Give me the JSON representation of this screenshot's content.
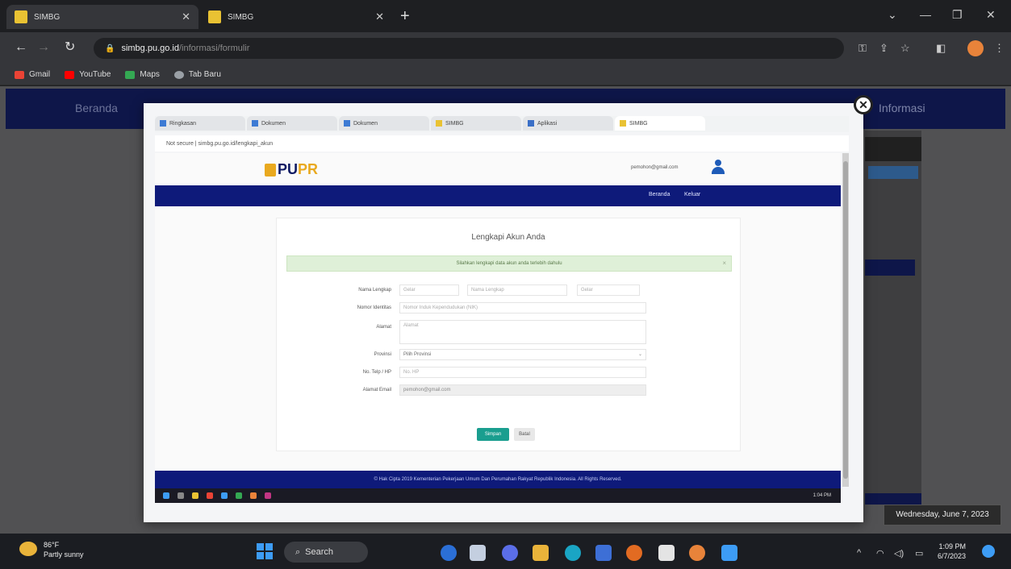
{
  "browser": {
    "tabs": [
      {
        "title": "SIMBG",
        "active": true
      },
      {
        "title": "SIMBG",
        "active": false
      }
    ],
    "new_tab": "+",
    "url_host": "simbg.pu.go.id",
    "url_path": "/informasi/formulir",
    "bookmarks": [
      {
        "label": "Gmail",
        "color": "#ea4335"
      },
      {
        "label": "YouTube",
        "color": "#ff0000"
      },
      {
        "label": "Maps",
        "color": "#34a853"
      },
      {
        "label": "Tab Baru",
        "color": "#9aa0a6"
      }
    ]
  },
  "background_page": {
    "nav_left": "Beranda",
    "nav_right": "Informasi"
  },
  "modal": {
    "close_symbol": "✕",
    "inner_tabs": [
      "Ringkasan",
      "Dokumen",
      "Dokumen",
      "SIMBG",
      "Aplikasi",
      "SIMBG"
    ],
    "inner_url": "Not secure | simbg.pu.go.id/lengkapi_akun",
    "site": {
      "logo_main": "PU",
      "logo_accent": "PR",
      "user_email": "pemohon@gmail.com",
      "nav_links": [
        "Beranda",
        "Keluar"
      ],
      "card_title": "Lengkapi Akun Anda",
      "alert_text": "Silahkan lengkapi data akun anda terlebih dahulu",
      "alert_close": "×",
      "form": {
        "nama_lengkap_label": "Nama Lengkap",
        "nama_fields": [
          "Gelar",
          "Nama Lengkap",
          "Gelar"
        ],
        "nomor_identitas_label": "Nomor Identitas",
        "nomor_identitas_placeholder": "Nomor Induk Kependudukan (NIK)",
        "alamat_label": "Alamat",
        "alamat_placeholder": "Alamat",
        "provinsi_label": "Provinsi",
        "provinsi_value": "Pilih Provinsi",
        "no_hp_label": "No. Telp / HP",
        "no_hp_placeholder": "No. HP",
        "email_label": "Alamat Email",
        "email_value": "pemohon@gmail.com"
      },
      "submit_label": "Simpan",
      "reset_label": "Batal",
      "footer_text": "© Hak Cipta 2019 Kementerian Pekerjaan Umum Dan Perumahan Rakyat Republik Indonesia. All Rights Reserved.",
      "taskbar_time": "1:04 PM"
    }
  },
  "tooltip": "Wednesday, June 7, 2023",
  "taskbar": {
    "weather_temp": "86°F",
    "weather_desc": "Partly sunny",
    "search_label": "Search",
    "time": "1:09 PM",
    "date": "6/7/2023"
  }
}
